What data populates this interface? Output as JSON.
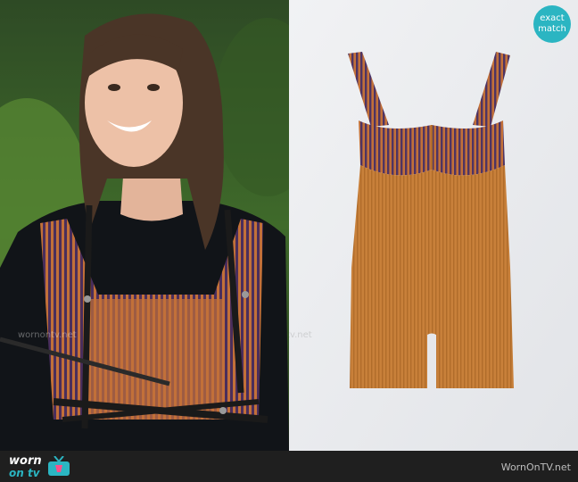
{
  "badge": {
    "line1": "exact",
    "line2": "match"
  },
  "footer": {
    "logo_worn": "worn",
    "logo_ontv": "on tv",
    "site": "WornOnTV.net"
  },
  "watermarks": [
    "wornontv.net",
    "wornontv.net"
  ],
  "colors": {
    "accent": "#2bb5c2",
    "footer_bg": "#1f1f1f",
    "garment": "#c27a32",
    "stripe": "#5a3a6a"
  }
}
